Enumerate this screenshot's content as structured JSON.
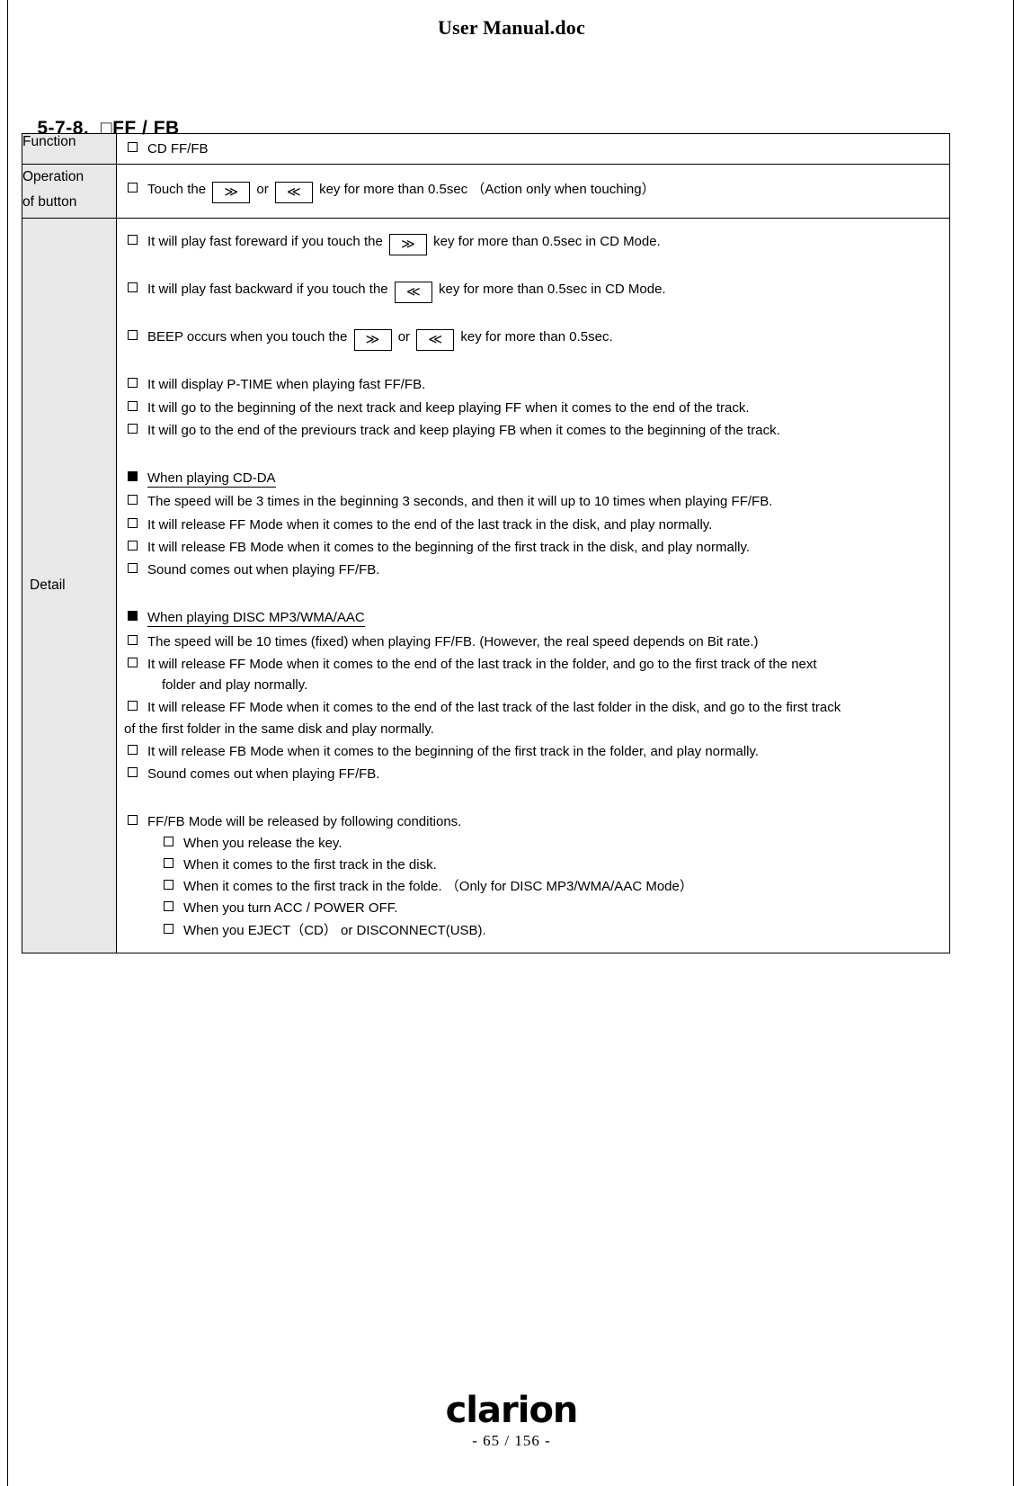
{
  "header": {
    "title": "User Manual.doc"
  },
  "section": {
    "number": "5-7-8.",
    "square": "□",
    "title": "FF / FB"
  },
  "table": {
    "labels": {
      "function": "Function",
      "operation_line1": "Operation",
      "operation_line2": "of button",
      "detail": "Detail"
    },
    "function_row": {
      "item": "CD FF/FB"
    },
    "operation_row": {
      "prefix": "Touch the",
      "key_ff": "≫",
      "or": "or",
      "key_fb": "≪",
      "suffix": "key for more than 0.5sec  （Action only when touching）"
    },
    "detail_row": {
      "intro_items": [
        {
          "prefix": "It will play fast foreward if you touch the",
          "key": "≫",
          "suffix": "key for more than 0.5sec in CD Mode."
        },
        {
          "prefix": "It will play fast backward if you touch the",
          "key": "≪",
          "suffix": "key for more than 0.5sec in CD Mode."
        }
      ],
      "beep_item": {
        "prefix": "BEEP occurs when you touch the",
        "key_ff": "≫",
        "or": "or",
        "key_fb": "≪",
        "suffix": "key for more than 0.5sec."
      },
      "plain_items": [
        "It will display P-TIME when playing fast FF/FB.",
        "It will go to the beginning of the next track and keep playing FF when it comes to the end of the track.",
        "It will go to the end of the previours track and keep playing FB when it comes to the beginning of the track."
      ],
      "cdda_group": {
        "heading": "When playing CD-DA",
        "items": [
          "The speed will be 3 times in the beginning 3 seconds, and then it will up to 10 times when playing FF/FB.",
          "It will release FF Mode when it comes to the end of the last track in the disk, and play normally.",
          "It will release FB Mode when it comes to the beginning of the first track in the disk, and play normally.",
          "Sound comes out when playing FF/FB."
        ]
      },
      "mp3_group": {
        "heading": "When playing DISC MP3/WMA/AAC",
        "item1": "The speed will be 10 times (fixed) when playing FF/FB. (However, the real speed depends on Bit rate.)",
        "item2_line1": "It will release FF Mode when it comes to the end of the last track in the folder, and go to the first track of the next",
        "item2_line2": "folder and play normally.",
        "item3_line1": "It will release FF Mode when it comes to the end of the last track of the last folder in the disk, and go to the first track",
        "item3_line2": "of the first folder in the same disk and play normally.",
        "item4": "It will release FB Mode when it comes to the beginning of the first track in the folder, and play normally.",
        "item5": "Sound comes out when playing FF/FB."
      },
      "release_group": {
        "heading": "FF/FB Mode will be released by following conditions.",
        "conditions": [
          "When you release the key.",
          "When it comes to the first track in the disk.",
          "When it comes to the first track in the folde.  （Only for DISC MP3/WMA/AAC Mode）",
          "When you turn ACC / POWER  OFF.",
          "When you EJECT（CD） or DISCONNECT(USB)."
        ]
      }
    }
  },
  "footer": {
    "brand": "clarion",
    "page": "- 65 / 156 -"
  },
  "colors": {
    "label_bg": "#e8e8e8",
    "border": "#000000",
    "text": "#000000"
  }
}
